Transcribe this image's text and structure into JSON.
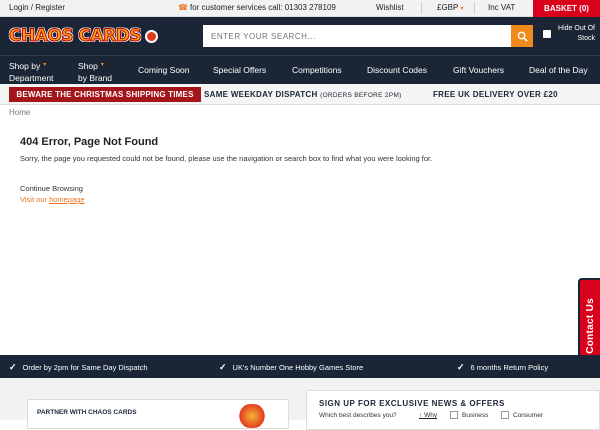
{
  "topbar": {
    "login": "Login / Register",
    "phone": "for customer services call: 01303 278109",
    "wishlist": "Wishlist",
    "currency": "£GBP",
    "vat": "Inc VAT",
    "basket": "BASKET (0)"
  },
  "header": {
    "logo_text": "CHAOS CARDS",
    "search_placeholder": "ENTER YOUR SEARCH...",
    "hide_stock": "Hide Out Of Stock"
  },
  "nav": {
    "items": [
      {
        "label": "Shop by",
        "label2": "Department"
      },
      {
        "label": "Shop",
        "label2": "by Brand"
      },
      {
        "label": "Coming Soon"
      },
      {
        "label": "Special Offers"
      },
      {
        "label": "Competitions"
      },
      {
        "label": "Discount Codes"
      },
      {
        "label": "Gift Vouchers"
      },
      {
        "label": "Deal of the Day"
      }
    ]
  },
  "promo": {
    "xmas": "BEWARE THE CHRISTMAS SHIPPING TIMES",
    "same_day": "SAME WEEKDAY DISPATCH",
    "same_day_note": "(ORDERS BEFORE 2PM)",
    "free": "FREE UK DELIVERY OVER £20"
  },
  "breadcrumb": "Home",
  "error": {
    "title": "404 Error, Page Not Found",
    "message": "Sorry, the page you requested could not be found, please use the navigation or search box to find what you were looking for.",
    "continue": "Continue Browsing",
    "visit_prefix": "Visit our",
    "homepage_link": "homepage"
  },
  "contact_tab": "Contact Us",
  "usp": [
    "Order by 2pm for Same Day Dispatch",
    "UK's Number One Hobby Games Store",
    "6 months Return Policy"
  ],
  "partner": {
    "title": "PARTNER WITH CHAOS CARDS"
  },
  "signup": {
    "title": "SIGN UP FOR EXCLUSIVE NEWS & OFFERS",
    "question": "Which best describes you?",
    "why": "Why",
    "options": [
      "Business",
      "Consumer"
    ]
  },
  "colors": {
    "navy": "#1a2636",
    "orange": "#f08a1c",
    "red": "#d9001b"
  }
}
